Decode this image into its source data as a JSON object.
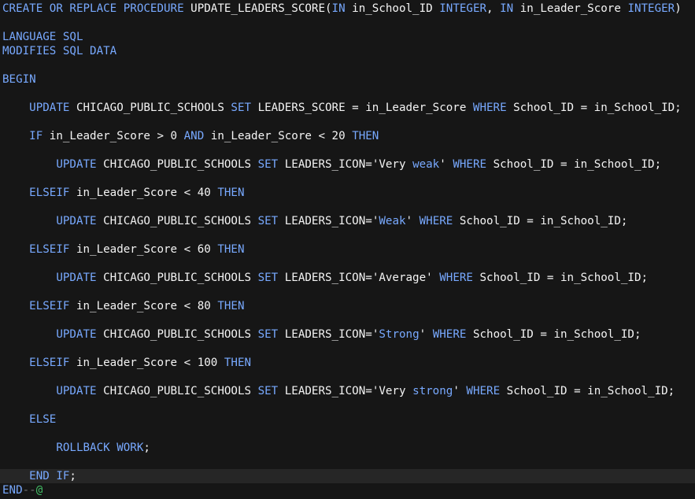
{
  "editor": {
    "lines": [
      [
        {
          "t": "CREATE OR REPLACE PROCEDURE",
          "c": "kw"
        },
        {
          "t": " UPDATE_LEADERS_SCORE(",
          "c": "plain"
        },
        {
          "t": "IN",
          "c": "kw"
        },
        {
          "t": " in_School_ID ",
          "c": "plain"
        },
        {
          "t": "INTEGER",
          "c": "kw"
        },
        {
          "t": ", ",
          "c": "plain"
        },
        {
          "t": "IN",
          "c": "kw"
        },
        {
          "t": " in_Leader_Score ",
          "c": "plain"
        },
        {
          "t": "INTEGER",
          "c": "kw"
        },
        {
          "t": ")",
          "c": "plain"
        }
      ],
      [],
      [
        {
          "t": "LANGUAGE SQL",
          "c": "kw"
        }
      ],
      [
        {
          "t": "MODIFIES SQL DATA",
          "c": "kw"
        }
      ],
      [],
      [
        {
          "t": "BEGIN",
          "c": "kw"
        }
      ],
      [],
      [
        {
          "t": "    ",
          "c": "plain"
        },
        {
          "t": "UPDATE",
          "c": "kw"
        },
        {
          "t": " CHICAGO_PUBLIC_SCHOOLS ",
          "c": "plain"
        },
        {
          "t": "SET",
          "c": "kw"
        },
        {
          "t": " LEADERS_SCORE = in_Leader_Score ",
          "c": "plain"
        },
        {
          "t": "WHERE",
          "c": "kw"
        },
        {
          "t": " School_ID = in_School_ID;",
          "c": "plain"
        }
      ],
      [],
      [
        {
          "t": "    ",
          "c": "plain"
        },
        {
          "t": "IF",
          "c": "kw"
        },
        {
          "t": " in_Leader_Score > 0 ",
          "c": "plain"
        },
        {
          "t": "AND",
          "c": "kw"
        },
        {
          "t": " in_Leader_Score < 20 ",
          "c": "plain"
        },
        {
          "t": "THEN",
          "c": "kw"
        }
      ],
      [],
      [
        {
          "t": "        ",
          "c": "plain"
        },
        {
          "t": "UPDATE",
          "c": "kw"
        },
        {
          "t": " CHICAGO_PUBLIC_SCHOOLS ",
          "c": "plain"
        },
        {
          "t": "SET",
          "c": "kw"
        },
        {
          "t": " LEADERS_ICON=",
          "c": "plain"
        },
        {
          "t": "'Very ",
          "c": "str"
        },
        {
          "t": "weak",
          "c": "strkw"
        },
        {
          "t": "' ",
          "c": "str"
        },
        {
          "t": "WHERE",
          "c": "kw"
        },
        {
          "t": " School_ID = in_School_ID;",
          "c": "plain"
        }
      ],
      [],
      [
        {
          "t": "    ",
          "c": "plain"
        },
        {
          "t": "ELSEIF",
          "c": "kw"
        },
        {
          "t": " in_Leader_Score < 40 ",
          "c": "plain"
        },
        {
          "t": "THEN",
          "c": "kw"
        }
      ],
      [],
      [
        {
          "t": "        ",
          "c": "plain"
        },
        {
          "t": "UPDATE",
          "c": "kw"
        },
        {
          "t": " CHICAGO_PUBLIC_SCHOOLS ",
          "c": "plain"
        },
        {
          "t": "SET",
          "c": "kw"
        },
        {
          "t": " LEADERS_ICON=",
          "c": "plain"
        },
        {
          "t": "'",
          "c": "str"
        },
        {
          "t": "Weak",
          "c": "strkw"
        },
        {
          "t": "' ",
          "c": "str"
        },
        {
          "t": "WHERE",
          "c": "kw"
        },
        {
          "t": " School_ID = in_School_ID;",
          "c": "plain"
        }
      ],
      [],
      [
        {
          "t": "    ",
          "c": "plain"
        },
        {
          "t": "ELSEIF",
          "c": "kw"
        },
        {
          "t": " in_Leader_Score < 60 ",
          "c": "plain"
        },
        {
          "t": "THEN",
          "c": "kw"
        }
      ],
      [],
      [
        {
          "t": "        ",
          "c": "plain"
        },
        {
          "t": "UPDATE",
          "c": "kw"
        },
        {
          "t": " CHICAGO_PUBLIC_SCHOOLS ",
          "c": "plain"
        },
        {
          "t": "SET",
          "c": "kw"
        },
        {
          "t": " LEADERS_ICON=",
          "c": "plain"
        },
        {
          "t": "'Average' ",
          "c": "str"
        },
        {
          "t": "WHERE",
          "c": "kw"
        },
        {
          "t": " School_ID = in_School_ID;",
          "c": "plain"
        }
      ],
      [],
      [
        {
          "t": "    ",
          "c": "plain"
        },
        {
          "t": "ELSEIF",
          "c": "kw"
        },
        {
          "t": " in_Leader_Score < 80 ",
          "c": "plain"
        },
        {
          "t": "THEN",
          "c": "kw"
        }
      ],
      [],
      [
        {
          "t": "        ",
          "c": "plain"
        },
        {
          "t": "UPDATE",
          "c": "kw"
        },
        {
          "t": " CHICAGO_PUBLIC_SCHOOLS ",
          "c": "plain"
        },
        {
          "t": "SET",
          "c": "kw"
        },
        {
          "t": " LEADERS_ICON=",
          "c": "plain"
        },
        {
          "t": "'",
          "c": "str"
        },
        {
          "t": "Strong",
          "c": "strkw"
        },
        {
          "t": "' ",
          "c": "str"
        },
        {
          "t": "WHERE",
          "c": "kw"
        },
        {
          "t": " School_ID = in_School_ID;",
          "c": "plain"
        }
      ],
      [],
      [
        {
          "t": "    ",
          "c": "plain"
        },
        {
          "t": "ELSEIF",
          "c": "kw"
        },
        {
          "t": " in_Leader_Score < 100 ",
          "c": "plain"
        },
        {
          "t": "THEN",
          "c": "kw"
        }
      ],
      [],
      [
        {
          "t": "        ",
          "c": "plain"
        },
        {
          "t": "UPDATE",
          "c": "kw"
        },
        {
          "t": " CHICAGO_PUBLIC_SCHOOLS ",
          "c": "plain"
        },
        {
          "t": "SET",
          "c": "kw"
        },
        {
          "t": " LEADERS_ICON=",
          "c": "plain"
        },
        {
          "t": "'Very ",
          "c": "str"
        },
        {
          "t": "strong",
          "c": "strkw"
        },
        {
          "t": "' ",
          "c": "str"
        },
        {
          "t": "WHERE",
          "c": "kw"
        },
        {
          "t": " School_ID = in_School_ID;",
          "c": "plain"
        }
      ],
      [],
      [
        {
          "t": "    ",
          "c": "plain"
        },
        {
          "t": "ELSE",
          "c": "kw"
        }
      ],
      [],
      [
        {
          "t": "        ",
          "c": "plain"
        },
        {
          "t": "ROLLBACK WORK",
          "c": "kw"
        },
        {
          "t": ";",
          "c": "plain"
        }
      ],
      [],
      [
        {
          "t": "    ",
          "c": "plain"
        },
        {
          "t": "END IF",
          "c": "kw"
        },
        {
          "t": ";",
          "c": "plain"
        }
      ],
      [
        {
          "t": "END",
          "c": "kw"
        },
        {
          "t": "--",
          "c": "cmt"
        },
        {
          "t": "@",
          "c": "term"
        }
      ]
    ],
    "current_line_index": 33,
    "colors": {
      "background": "#161616",
      "current_line": "#262626",
      "keyword": "#78a9ff",
      "text": "#f4f4f4",
      "comment": "#6f6f6f",
      "terminator": "#42be65"
    }
  }
}
